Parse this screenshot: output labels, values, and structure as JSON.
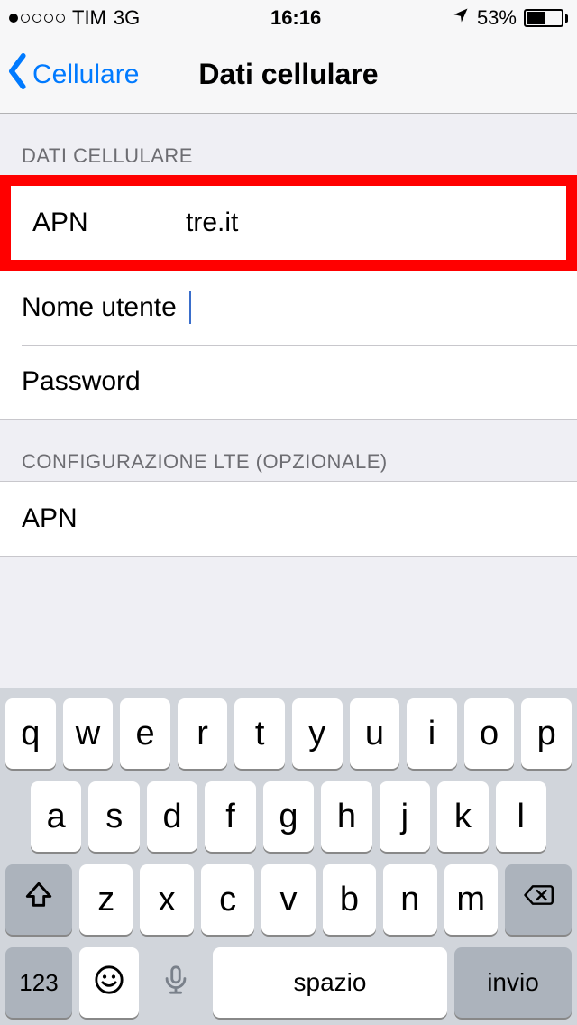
{
  "statusbar": {
    "carrier": "TIM",
    "network": "3G",
    "time": "16:16",
    "battery_pct": "53%"
  },
  "nav": {
    "back_label": "Cellulare",
    "title": "Dati cellulare"
  },
  "sections": {
    "cellular": {
      "header": "DATI CELLULARE",
      "apn_label": "APN",
      "apn_value": "tre.it",
      "user_label": "Nome utente",
      "user_value": "",
      "password_label": "Password",
      "password_value": ""
    },
    "lte": {
      "header": "CONFIGURAZIONE LTE (OPZIONALE)",
      "apn_label": "APN",
      "apn_value": ""
    }
  },
  "keyboard": {
    "rows": [
      [
        "q",
        "w",
        "e",
        "r",
        "t",
        "y",
        "u",
        "i",
        "o",
        "p"
      ],
      [
        "a",
        "s",
        "d",
        "f",
        "g",
        "h",
        "j",
        "k",
        "l"
      ],
      [
        "z",
        "x",
        "c",
        "v",
        "b",
        "n",
        "m"
      ]
    ],
    "numkey": "123",
    "space": "spazio",
    "enter": "invio"
  }
}
